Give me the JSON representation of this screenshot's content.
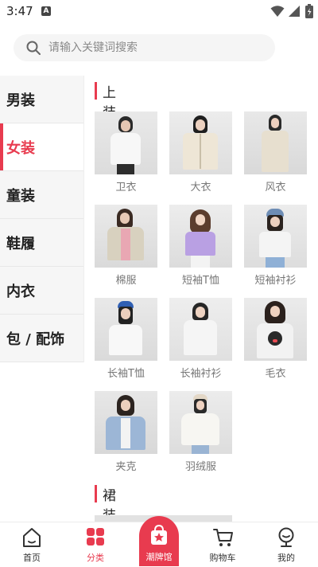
{
  "status": {
    "time": "3:47",
    "badge": "A"
  },
  "search": {
    "placeholder": "请输入关键词搜索",
    "value": ""
  },
  "categories": [
    {
      "label": "男装",
      "active": false
    },
    {
      "label": "女装",
      "active": true
    },
    {
      "label": "童装",
      "active": false
    },
    {
      "label": "鞋履",
      "active": false
    },
    {
      "label": "内衣",
      "active": false
    },
    {
      "label": "包 / 配饰",
      "active": false
    }
  ],
  "sections": [
    {
      "title": "上装",
      "items": [
        {
          "label": "卫衣"
        },
        {
          "label": "大衣"
        },
        {
          "label": "风衣"
        },
        {
          "label": "棉服"
        },
        {
          "label": "短袖T恤"
        },
        {
          "label": "短袖衬衫"
        },
        {
          "label": "长袖T恤"
        },
        {
          "label": "长袖衬衫"
        },
        {
          "label": "毛衣"
        },
        {
          "label": "夹克"
        },
        {
          "label": "羽绒服"
        }
      ]
    },
    {
      "title": "裙装",
      "items": []
    }
  ],
  "nav": [
    {
      "label": "首页",
      "icon": "home-icon",
      "active": false
    },
    {
      "label": "分类",
      "icon": "category-icon",
      "active": true
    },
    {
      "label": "潮牌馆",
      "icon": "shopping-bag-star-icon",
      "active": false
    },
    {
      "label": "购物车",
      "icon": "cart-icon",
      "active": false
    },
    {
      "label": "我的",
      "icon": "user-icon",
      "active": false
    }
  ],
  "colors": {
    "accent": "#e83b4f",
    "sidebar_bg": "#f6f6f6",
    "search_bg": "#f5f5f5"
  }
}
